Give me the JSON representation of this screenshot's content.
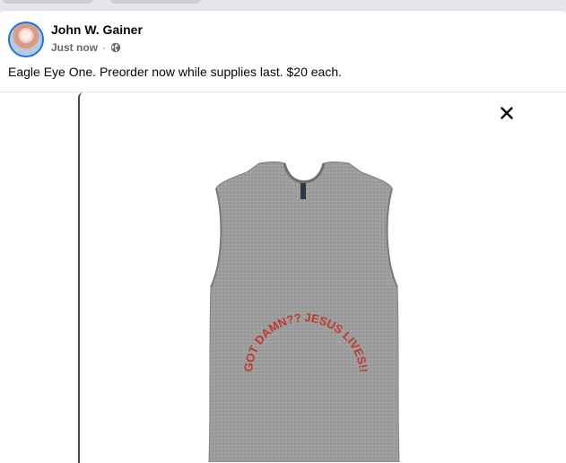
{
  "post": {
    "author": "John W. Gainer",
    "timestamp": "Just now",
    "separator": "·",
    "privacy_icon": "globe-icon",
    "text": "Eagle Eye One. Preorder now while supplies last. $20 each."
  },
  "photo": {
    "close_icon": "close-icon",
    "subject": "shirt-image",
    "print_text_left": "GOT DAMN???",
    "print_text_right": "JESUS LIVES!!!"
  },
  "colors": {
    "link_blue": "#1b74e4",
    "text_primary": "#050505",
    "text_secondary": "#65676b",
    "shirt_gray": "#9a9a9a",
    "print_red": "#c0392b"
  }
}
